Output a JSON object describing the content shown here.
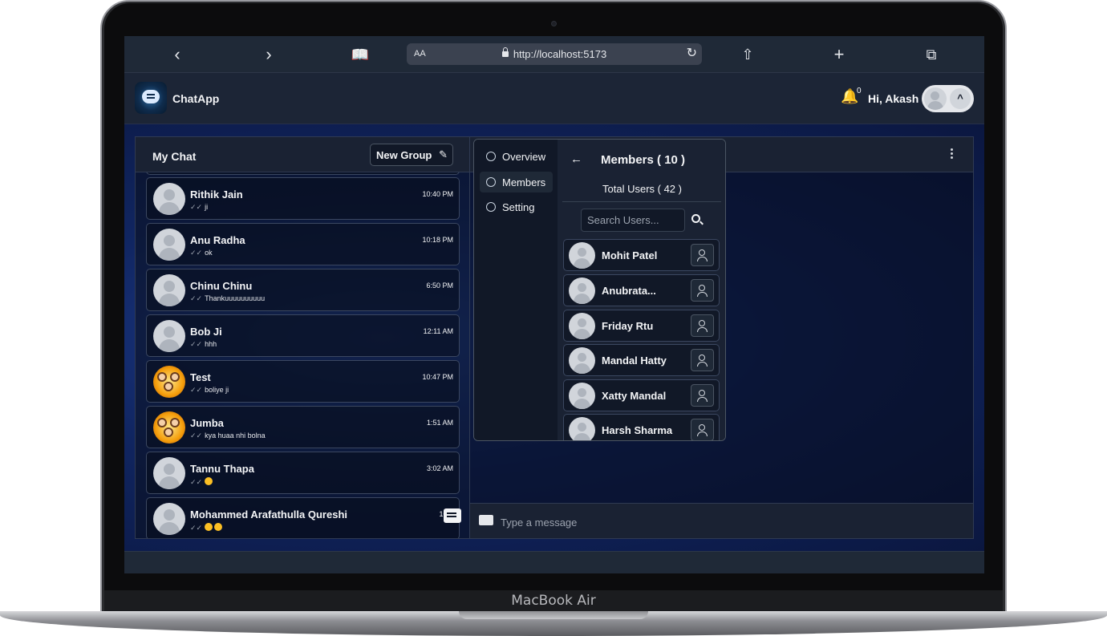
{
  "device": {
    "label": "MacBook Air"
  },
  "browser": {
    "aa_label": "AA",
    "url": "http://localhost:5173",
    "icons": [
      "back-icon",
      "forward-icon",
      "bookmarks-icon",
      "reload-icon",
      "share-icon",
      "new-tab-icon",
      "tabs-icon"
    ]
  },
  "header": {
    "app_name": "ChatApp",
    "notification_count": "0",
    "greeting": "Hi, Akash",
    "toggle_symbol": "^"
  },
  "chat_list": {
    "title": "My Chat",
    "new_group_label": "New Group",
    "items": [
      {
        "name": "Rithik Jain",
        "time": "10:40 PM",
        "last": "ji",
        "group": false
      },
      {
        "name": "Anu Radha",
        "time": "10:18 PM",
        "last": "ok",
        "group": false
      },
      {
        "name": "Chinu Chinu",
        "time": "6:50 PM",
        "last": "Thankuuuuuuuuuu",
        "group": false
      },
      {
        "name": "Bob Ji",
        "time": "12:11 AM",
        "last": "hhh",
        "group": false
      },
      {
        "name": "Test",
        "time": "10:47 PM",
        "last": "boliye ji",
        "group": true
      },
      {
        "name": "Jumba",
        "time": "1:51 AM",
        "last": "kya huaa nhi bolna",
        "group": true
      },
      {
        "name": "Tannu Thapa",
        "time": "3:02 AM",
        "last": "",
        "emoji_count": 1,
        "group": false
      },
      {
        "name": "Mohammed Arafathulla Qureshi",
        "time": "10:0",
        "last": "",
        "emoji_count": 2,
        "group": false
      }
    ]
  },
  "group_modal": {
    "tabs": [
      {
        "label": "Overview",
        "icon": "info-icon"
      },
      {
        "label": "Members",
        "icon": "users-icon"
      },
      {
        "label": "Setting",
        "icon": "gear-icon"
      }
    ],
    "active_tab": "Members",
    "members_title": "Members ( 10 )",
    "total_users": "Total Users ( 42 )",
    "search_placeholder": "Search Users...",
    "members": [
      "Mohit Patel",
      "Anubrata...",
      "Friday Rtu",
      "Mandal Hatty",
      "Xatty Mandal",
      "Harsh Sharma"
    ]
  },
  "composer": {
    "placeholder": "Type a message"
  },
  "colors": {
    "background_gradient": "#102560",
    "panel": "#1a2233",
    "text": "#f3f4f6"
  }
}
